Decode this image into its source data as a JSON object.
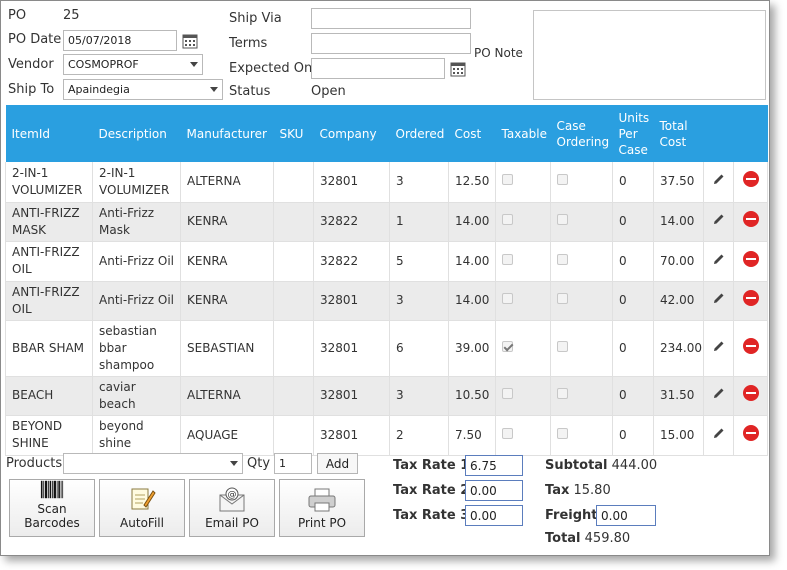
{
  "header": {
    "po_label": "PO",
    "po_value": "25",
    "po_date_label": "PO Date",
    "po_date_value": "05/07/2018",
    "vendor_label": "Vendor",
    "vendor_value": "COSMOPROF",
    "ship_to_label": "Ship To",
    "ship_to_value": "Apaindegia",
    "ship_via_label": "Ship Via",
    "ship_via_value": "",
    "terms_label": "Terms",
    "terms_value": "",
    "expected_on_label": "Expected On",
    "expected_on_value": "",
    "status_label": "Status",
    "status_value": "Open",
    "po_note_label": "PO Note",
    "po_note_value": ""
  },
  "table": {
    "header_color": "#2a9fe0",
    "columns": [
      "ItemId",
      "Description",
      "Manufacturer",
      "SKU",
      "Company",
      "Ordered",
      "Cost",
      "Taxable",
      "Case Ordering",
      "Units Per Case",
      "Total Cost"
    ],
    "rows": [
      {
        "itemid": "2-IN-1 VOLUMIZER",
        "description": "2-IN-1 VOLUMIZER",
        "manufacturer": "ALTERNA",
        "sku": "",
        "company": "32801",
        "ordered": "3",
        "cost": "12.50",
        "taxable": false,
        "case_ordering": false,
        "units_per_case": "0",
        "total_cost": "37.50"
      },
      {
        "itemid": "ANTI-FRIZZ MASK",
        "description": "Anti-Frizz Mask",
        "manufacturer": "KENRA",
        "sku": "",
        "company": "32822",
        "ordered": "1",
        "cost": "14.00",
        "taxable": false,
        "case_ordering": false,
        "units_per_case": "0",
        "total_cost": "14.00"
      },
      {
        "itemid": "ANTI-FRIZZ OIL",
        "description": "Anti-Frizz Oil",
        "manufacturer": "KENRA",
        "sku": "",
        "company": "32822",
        "ordered": "5",
        "cost": "14.00",
        "taxable": false,
        "case_ordering": false,
        "units_per_case": "0",
        "total_cost": "70.00"
      },
      {
        "itemid": "ANTI-FRIZZ OIL",
        "description": "Anti-Frizz Oil",
        "manufacturer": "KENRA",
        "sku": "",
        "company": "32801",
        "ordered": "3",
        "cost": "14.00",
        "taxable": false,
        "case_ordering": false,
        "units_per_case": "0",
        "total_cost": "42.00"
      },
      {
        "itemid": "BBAR SHAM",
        "description": "sebastian bbar shampoo",
        "manufacturer": "SEBASTIAN",
        "sku": "",
        "company": "32801",
        "ordered": "6",
        "cost": "39.00",
        "taxable": true,
        "case_ordering": false,
        "units_per_case": "0",
        "total_cost": "234.00"
      },
      {
        "itemid": "BEACH",
        "description": "caviar beach",
        "manufacturer": "ALTERNA",
        "sku": "",
        "company": "32801",
        "ordered": "3",
        "cost": "10.50",
        "taxable": false,
        "case_ordering": false,
        "units_per_case": "0",
        "total_cost": "31.50"
      },
      {
        "itemid": "BEYOND SHINE",
        "description": "beyond shine",
        "manufacturer": "AQUAGE",
        "sku": "",
        "company": "32801",
        "ordered": "2",
        "cost": "7.50",
        "taxable": false,
        "case_ordering": false,
        "units_per_case": "0",
        "total_cost": "15.00"
      }
    ]
  },
  "bottom": {
    "products_label": "Products",
    "products_value": "",
    "qty_label": "Qty",
    "qty_value": "1",
    "add_label": "Add",
    "buttons": {
      "scan_line1": "Scan",
      "scan_line2": "Barcodes",
      "autofill": "AutoFill",
      "email": "Email PO",
      "print": "Print PO"
    },
    "tax_rate1_label": "Tax Rate 1",
    "tax_rate1_value": "6.75",
    "tax_rate2_label": "Tax Rate 2",
    "tax_rate2_value": "0.00",
    "tax_rate3_label": "Tax Rate 3",
    "tax_rate3_value": "0.00",
    "subtotal_label": "Subtotal",
    "subtotal_value": "444.00",
    "tax_label": "Tax",
    "tax_value": "15.80",
    "freight_label": "Freight",
    "freight_value": "0.00",
    "total_label": "Total",
    "total_value": "459.80"
  }
}
